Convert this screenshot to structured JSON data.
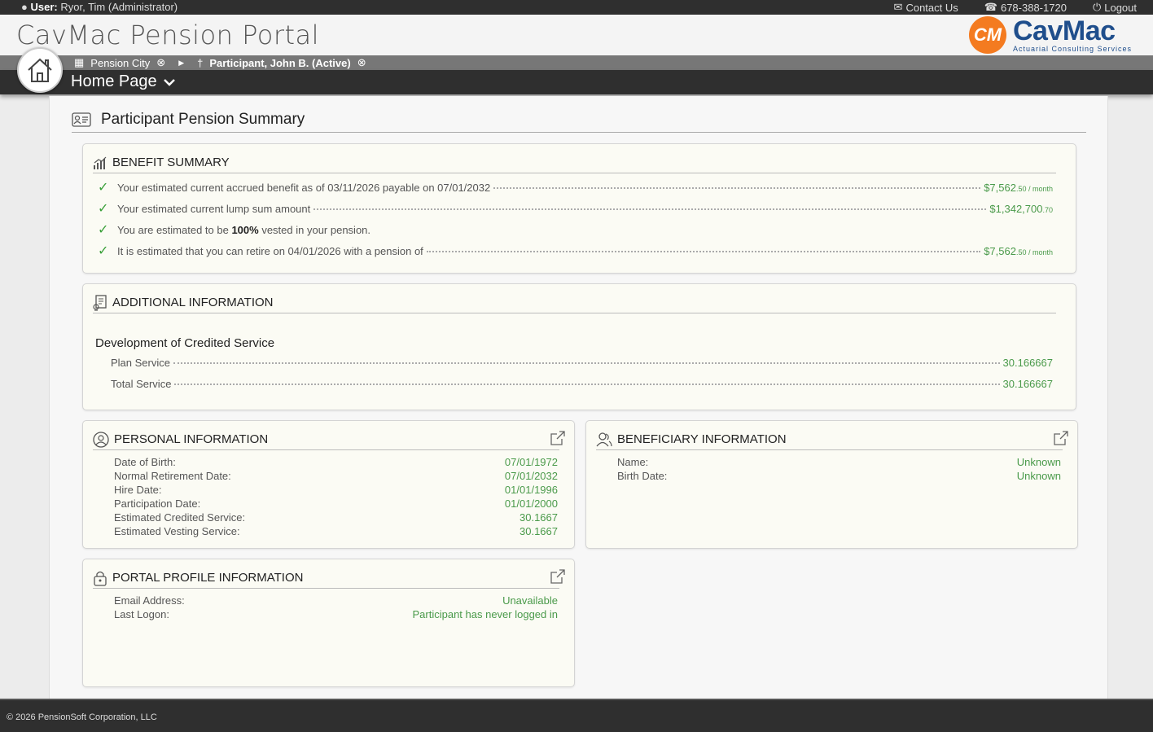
{
  "topbar": {
    "user_label": "User:",
    "user_name": "Ryor, Tim (Administrator)",
    "contact": "Contact Us",
    "phone": "678-388-1720",
    "logout": "Logout"
  },
  "header": {
    "title": "CavMac Pension Portal",
    "logo_mark": "CM",
    "logo_word": "CavMac",
    "logo_sub": "Actuarial Consulting Services"
  },
  "breadcrumb": {
    "org": "Pension City",
    "participant": "Participant, John B. (Active)"
  },
  "nav": {
    "page": "Home Page"
  },
  "summary": {
    "title": "Participant Pension Summary"
  },
  "benefit": {
    "title": "BENEFIT SUMMARY",
    "rows": [
      {
        "label": "Your estimated current accrued benefit as of 03/11/2026 payable on 07/01/2032",
        "value": "$7,562",
        "cents": ".50",
        "suffix": " / month"
      },
      {
        "label": "Your estimated current lump sum amount",
        "value": "$1,342,700",
        "cents": ".70",
        "suffix": ""
      },
      {
        "label_pre": "You are estimated to be ",
        "label_bold": "100%",
        "label_post": " vested in your pension."
      },
      {
        "label": "It is estimated that you can retire on 04/01/2026 with a pension of",
        "value": "$7,562",
        "cents": ".50",
        "suffix": " / month"
      }
    ]
  },
  "additional": {
    "title": "ADDITIONAL INFORMATION",
    "subtitle": "Development of Credited Service",
    "rows": [
      {
        "label": "Plan Service",
        "value": "30.166667"
      },
      {
        "label": "Total Service",
        "value": "30.166667"
      }
    ]
  },
  "personal": {
    "title": "PERSONAL INFORMATION",
    "rows": [
      {
        "label": "Date of Birth:",
        "value": "07/01/1972"
      },
      {
        "label": "Normal Retirement Date:",
        "value": "07/01/2032"
      },
      {
        "label": "Hire Date:",
        "value": "01/01/1996"
      },
      {
        "label": "Participation Date:",
        "value": "01/01/2000"
      },
      {
        "label": "Estimated Credited Service:",
        "value": "30.1667"
      },
      {
        "label": "Estimated Vesting Service:",
        "value": "30.1667"
      }
    ]
  },
  "beneficiary": {
    "title": "BENEFICIARY INFORMATION",
    "rows": [
      {
        "label": "Name:",
        "value": "Unknown"
      },
      {
        "label": "Birth Date:",
        "value": "Unknown"
      }
    ]
  },
  "portal": {
    "title": "PORTAL PROFILE INFORMATION",
    "rows": [
      {
        "label": "Email Address:",
        "value": "Unavailable"
      },
      {
        "label": "Last Logon:",
        "value": "Participant has never logged in"
      }
    ]
  },
  "footer": {
    "copyright": "© 2026 PensionSoft Corporation, LLC"
  },
  "colors": {
    "accent_green": "#4a9a4a",
    "dark_bar": "#2f2f2f",
    "logo_orange": "#f47b20",
    "logo_blue": "#1f4e8c"
  }
}
